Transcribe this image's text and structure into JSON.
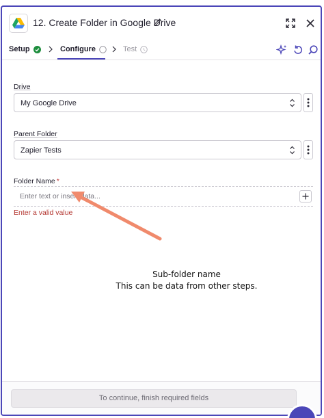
{
  "header": {
    "title": "12. Create Folder in Google Drive",
    "app_icon": "google-drive-icon",
    "edit_icon": "pencil-icon",
    "expand_icon": "expand-icon",
    "close_icon": "close-icon"
  },
  "tabs": [
    {
      "label": "Setup",
      "status": "complete",
      "status_icon": "check-circle-icon"
    },
    {
      "label": "Configure",
      "status": "active",
      "status_icon": "empty-circle-icon"
    },
    {
      "label": "Test",
      "status": "disabled",
      "status_icon": "clock-icon"
    }
  ],
  "toolbar_icons": [
    "sparkle-icon",
    "undo-icon",
    "search-icon"
  ],
  "fields": {
    "drive": {
      "label": "Drive",
      "value": "My Google Drive"
    },
    "parent_folder": {
      "label": "Parent Folder",
      "value": "Zapier Tests"
    },
    "folder_name": {
      "label": "Folder Name",
      "required_marker": "*",
      "placeholder": "Enter text or insert data...",
      "error": "Enter a valid value"
    }
  },
  "annotation": {
    "line1": "Sub-folder name",
    "line2": "This can be data from other steps."
  },
  "footer": {
    "button_label": "To continue, finish required fields"
  },
  "colors": {
    "accent": "#4b46b8",
    "success": "#1e8e3e",
    "error": "#b3352f",
    "arrow": "#f08a6c"
  }
}
